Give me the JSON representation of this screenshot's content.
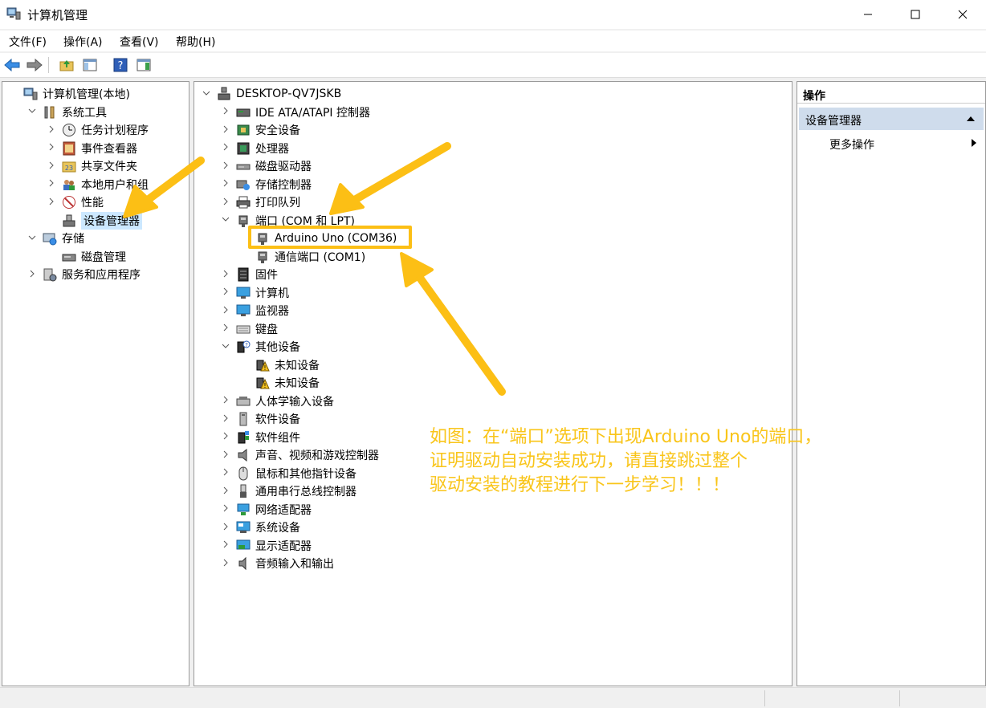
{
  "window": {
    "title": "计算机管理"
  },
  "menu": [
    "文件(F)",
    "操作(A)",
    "查看(V)",
    "帮助(H)"
  ],
  "left_tree": [
    {
      "label": "计算机管理(本地)",
      "icon": "computer-manage-icon",
      "level": 0,
      "expanded": null
    },
    {
      "label": "系统工具",
      "icon": "tools-icon",
      "level": 1,
      "expanded": true
    },
    {
      "label": "任务计划程序",
      "icon": "clock-icon",
      "level": 2,
      "expanded": false
    },
    {
      "label": "事件查看器",
      "icon": "event-viewer-icon",
      "level": 2,
      "expanded": false
    },
    {
      "label": "共享文件夹",
      "icon": "shared-folder-icon",
      "level": 2,
      "expanded": false
    },
    {
      "label": "本地用户和组",
      "icon": "users-icon",
      "level": 2,
      "expanded": false
    },
    {
      "label": "性能",
      "icon": "performance-icon",
      "level": 2,
      "expanded": false
    },
    {
      "label": "设备管理器",
      "icon": "device-manager-icon",
      "level": 2,
      "expanded": null,
      "selected": true
    },
    {
      "label": "存储",
      "icon": "storage-icon",
      "level": 1,
      "expanded": true
    },
    {
      "label": "磁盘管理",
      "icon": "disk-icon",
      "level": 2,
      "expanded": null
    },
    {
      "label": "服务和应用程序",
      "icon": "services-icon",
      "level": 1,
      "expanded": false
    }
  ],
  "device_tree": [
    {
      "label": "DESKTOP-QV7JSKB",
      "icon": "computer-icon",
      "level": 0,
      "expanded": true
    },
    {
      "label": "IDE ATA/ATAPI 控制器",
      "icon": "ide-icon",
      "level": 1,
      "expanded": false
    },
    {
      "label": "安全设备",
      "icon": "security-icon",
      "level": 1,
      "expanded": false
    },
    {
      "label": "处理器",
      "icon": "cpu-icon",
      "level": 1,
      "expanded": false
    },
    {
      "label": "磁盘驱动器",
      "icon": "disk-drive-icon",
      "level": 1,
      "expanded": false
    },
    {
      "label": "存储控制器",
      "icon": "storage-controller-icon",
      "level": 1,
      "expanded": false
    },
    {
      "label": "打印队列",
      "icon": "printer-icon",
      "level": 1,
      "expanded": false
    },
    {
      "label": "端口 (COM 和 LPT)",
      "icon": "port-icon",
      "level": 1,
      "expanded": true
    },
    {
      "label": "Arduino Uno (COM36)",
      "icon": "port-icon",
      "level": 2,
      "expanded": null,
      "highlight": true
    },
    {
      "label": "通信端口 (COM1)",
      "icon": "port-icon",
      "level": 2,
      "expanded": null
    },
    {
      "label": "固件",
      "icon": "firmware-icon",
      "level": 1,
      "expanded": false
    },
    {
      "label": "计算机",
      "icon": "monitor-icon",
      "level": 1,
      "expanded": false
    },
    {
      "label": "监视器",
      "icon": "monitor-icon",
      "level": 1,
      "expanded": false
    },
    {
      "label": "键盘",
      "icon": "keyboard-icon",
      "level": 1,
      "expanded": false
    },
    {
      "label": "其他设备",
      "icon": "other-devices-icon",
      "level": 1,
      "expanded": true
    },
    {
      "label": "未知设备",
      "icon": "warning-device-icon",
      "level": 2,
      "expanded": null
    },
    {
      "label": "未知设备",
      "icon": "warning-device-icon",
      "level": 2,
      "expanded": null
    },
    {
      "label": "人体学输入设备",
      "icon": "hid-icon",
      "level": 1,
      "expanded": false
    },
    {
      "label": "软件设备",
      "icon": "software-device-icon",
      "level": 1,
      "expanded": false
    },
    {
      "label": "软件组件",
      "icon": "software-component-icon",
      "level": 1,
      "expanded": false
    },
    {
      "label": "声音、视频和游戏控制器",
      "icon": "speaker-icon",
      "level": 1,
      "expanded": false
    },
    {
      "label": "鼠标和其他指针设备",
      "icon": "mouse-icon",
      "level": 1,
      "expanded": false
    },
    {
      "label": "通用串行总线控制器",
      "icon": "usb-icon",
      "level": 1,
      "expanded": false
    },
    {
      "label": "网络适配器",
      "icon": "network-icon",
      "level": 1,
      "expanded": false
    },
    {
      "label": "系统设备",
      "icon": "system-device-icon",
      "level": 1,
      "expanded": false
    },
    {
      "label": "显示适配器",
      "icon": "display-adapter-icon",
      "level": 1,
      "expanded": false
    },
    {
      "label": "音频输入和输出",
      "icon": "audio-icon",
      "level": 1,
      "expanded": false
    }
  ],
  "actions": {
    "header": "操作",
    "section": "设备管理器",
    "more": "更多操作"
  },
  "annotation": {
    "text": "如图：在“端口”选项下出现Arduino Uno的端口，\n证明驱动自动安装成功，请直接跳过整个\n驱动安装的教程进行下一步学习！！！",
    "color": "#f9c51a"
  }
}
